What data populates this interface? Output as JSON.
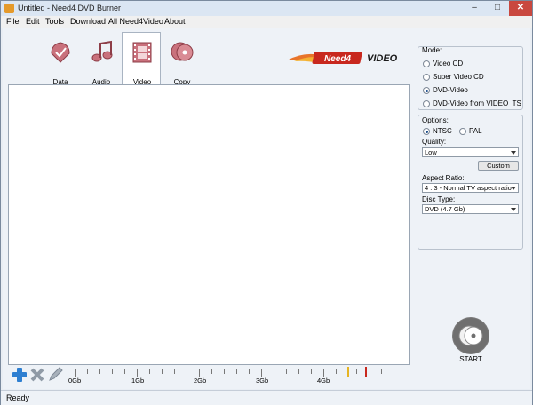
{
  "window": {
    "title": "Untitled - Need4 DVD Burner"
  },
  "menu": [
    "File",
    "Edit",
    "Tools",
    "Download",
    "All Need4Video",
    "About"
  ],
  "tabs": [
    {
      "label": "Data",
      "icon": "data-icon",
      "active": false
    },
    {
      "label": "Audio",
      "icon": "audio-icon",
      "active": false
    },
    {
      "label": "Video",
      "icon": "video-icon",
      "active": true
    },
    {
      "label": "Copy",
      "icon": "copy-icon",
      "active": false
    }
  ],
  "logo": {
    "text": "Need4 VIDEO"
  },
  "mode": {
    "title": "Mode:",
    "options": [
      "Video CD",
      "Super Video CD",
      "DVD-Video",
      "DVD-Video from VIDEO_TS"
    ],
    "selected": "DVD-Video"
  },
  "options": {
    "title": "Options:",
    "ntsc": "NTSC",
    "pal": "PAL",
    "selected": "NTSC",
    "quality_label": "Quality:",
    "quality_value": "Low",
    "custom_button": "Custom",
    "aspect_label": "Aspect Ratio:",
    "aspect_value": "4 : 3 - Normal TV aspect ratio",
    "disc_label": "Disc Type:",
    "disc_value": "DVD (4.7 Gb)"
  },
  "start": {
    "label": "START"
  },
  "scale": {
    "labels": [
      "0Gb",
      "1Gb",
      "2Gb",
      "3Gb",
      "4Gb"
    ]
  },
  "status": {
    "text": "Ready"
  },
  "colors": {
    "accent": "#1e4f8c",
    "marker_yellow": "#e6b422",
    "marker_red": "#c8281e",
    "close": "#c9483f"
  }
}
